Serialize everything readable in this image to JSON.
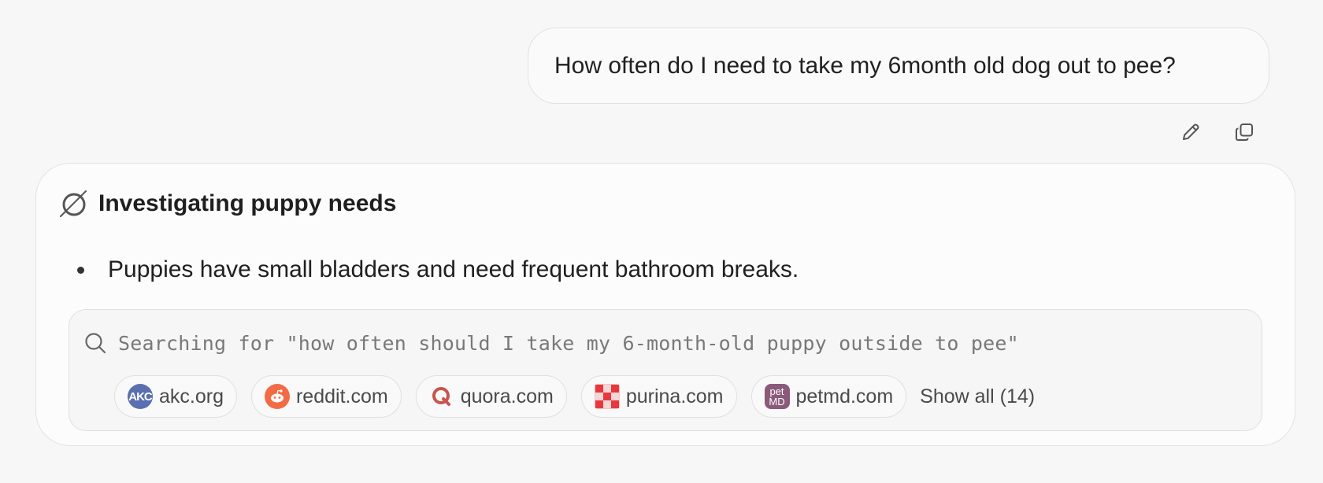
{
  "conversation": {
    "user_message": "How often do I need to take my 6month old dog out to pee?",
    "actions": {
      "edit_icon": "pencil-icon",
      "copy_icon": "copy-icon"
    }
  },
  "thinking_card": {
    "title": "Investigating puppy needs",
    "bullets": [
      "Puppies have small bladders and need frequent bathroom breaks."
    ],
    "search": {
      "query": "Searching for \"how often should I take my 6-month-old puppy outside to pee\"",
      "sources": [
        {
          "label": "akc.org",
          "icon": "akc-favicon",
          "color": "#5a6fb0"
        },
        {
          "label": "reddit.com",
          "icon": "reddit-favicon",
          "color": "#f26b45"
        },
        {
          "label": "quora.com",
          "icon": "quora-favicon",
          "color": "#c8554f"
        },
        {
          "label": "purina.com",
          "icon": "purina-favicon",
          "color": "#e8383d"
        },
        {
          "label": "petmd.com",
          "icon": "petmd-favicon",
          "color": "#8b5a7a"
        }
      ],
      "show_all": "Show all (14)"
    }
  },
  "logo_text": {
    "akc": "AKC",
    "petmd_top": "pet",
    "petmd_bottom": "MD"
  }
}
